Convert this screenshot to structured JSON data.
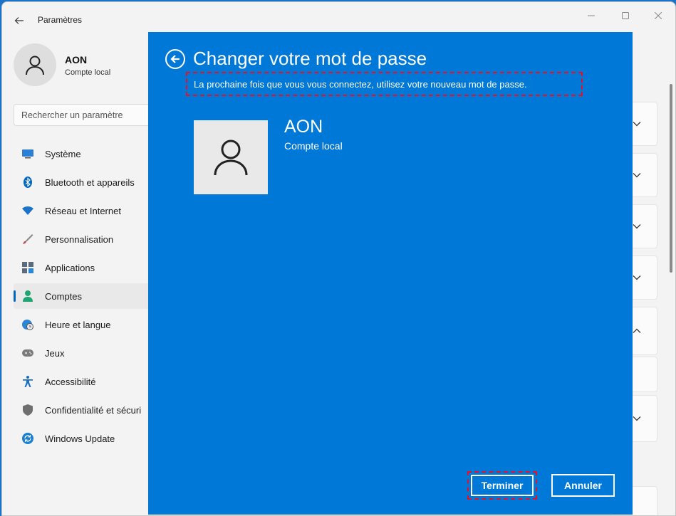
{
  "window": {
    "title": "Paramètres",
    "back_icon": "arrow-left-icon"
  },
  "profile": {
    "name": "AON",
    "account_type": "Compte local"
  },
  "search": {
    "placeholder": "Rechercher un paramètre"
  },
  "sidebar": {
    "items": [
      {
        "label": "Système",
        "icon": "monitor-icon",
        "color": "#2b7fd4"
      },
      {
        "label": "Bluetooth et appareils",
        "icon": "bluetooth-icon",
        "color": "#0067c0"
      },
      {
        "label": "Réseau et Internet",
        "icon": "wifi-icon",
        "color": "#1a73c9"
      },
      {
        "label": "Personnalisation",
        "icon": "brush-icon",
        "color": "#8a6a4a"
      },
      {
        "label": "Applications",
        "icon": "apps-icon",
        "color": "#5b6b7b"
      },
      {
        "label": "Comptes",
        "icon": "person-icon",
        "color": "#1ea672",
        "active": true
      },
      {
        "label": "Heure et langue",
        "icon": "globe-clock-icon",
        "color": "#2a86d6"
      },
      {
        "label": "Jeux",
        "icon": "gamepad-icon",
        "color": "#7a7a7a"
      },
      {
        "label": "Accessibilité",
        "icon": "accessibility-icon",
        "color": "#1b6fc0"
      },
      {
        "label": "Confidentialité et sécuri",
        "icon": "shield-icon",
        "color": "#6f6f6f"
      },
      {
        "label": "Windows Update",
        "icon": "update-icon",
        "color": "#1a7fd1"
      }
    ]
  },
  "dialog": {
    "title": "Changer votre mot de passe",
    "subtitle": "La prochaine fois que vous vous connectez, utilisez votre nouveau mot de passe.",
    "user_name": "AON",
    "account_type": "Compte local",
    "finish_label": "Terminer",
    "cancel_label": "Annuler",
    "background_color": "#0078d7",
    "highlight_color": "#e0132b"
  }
}
